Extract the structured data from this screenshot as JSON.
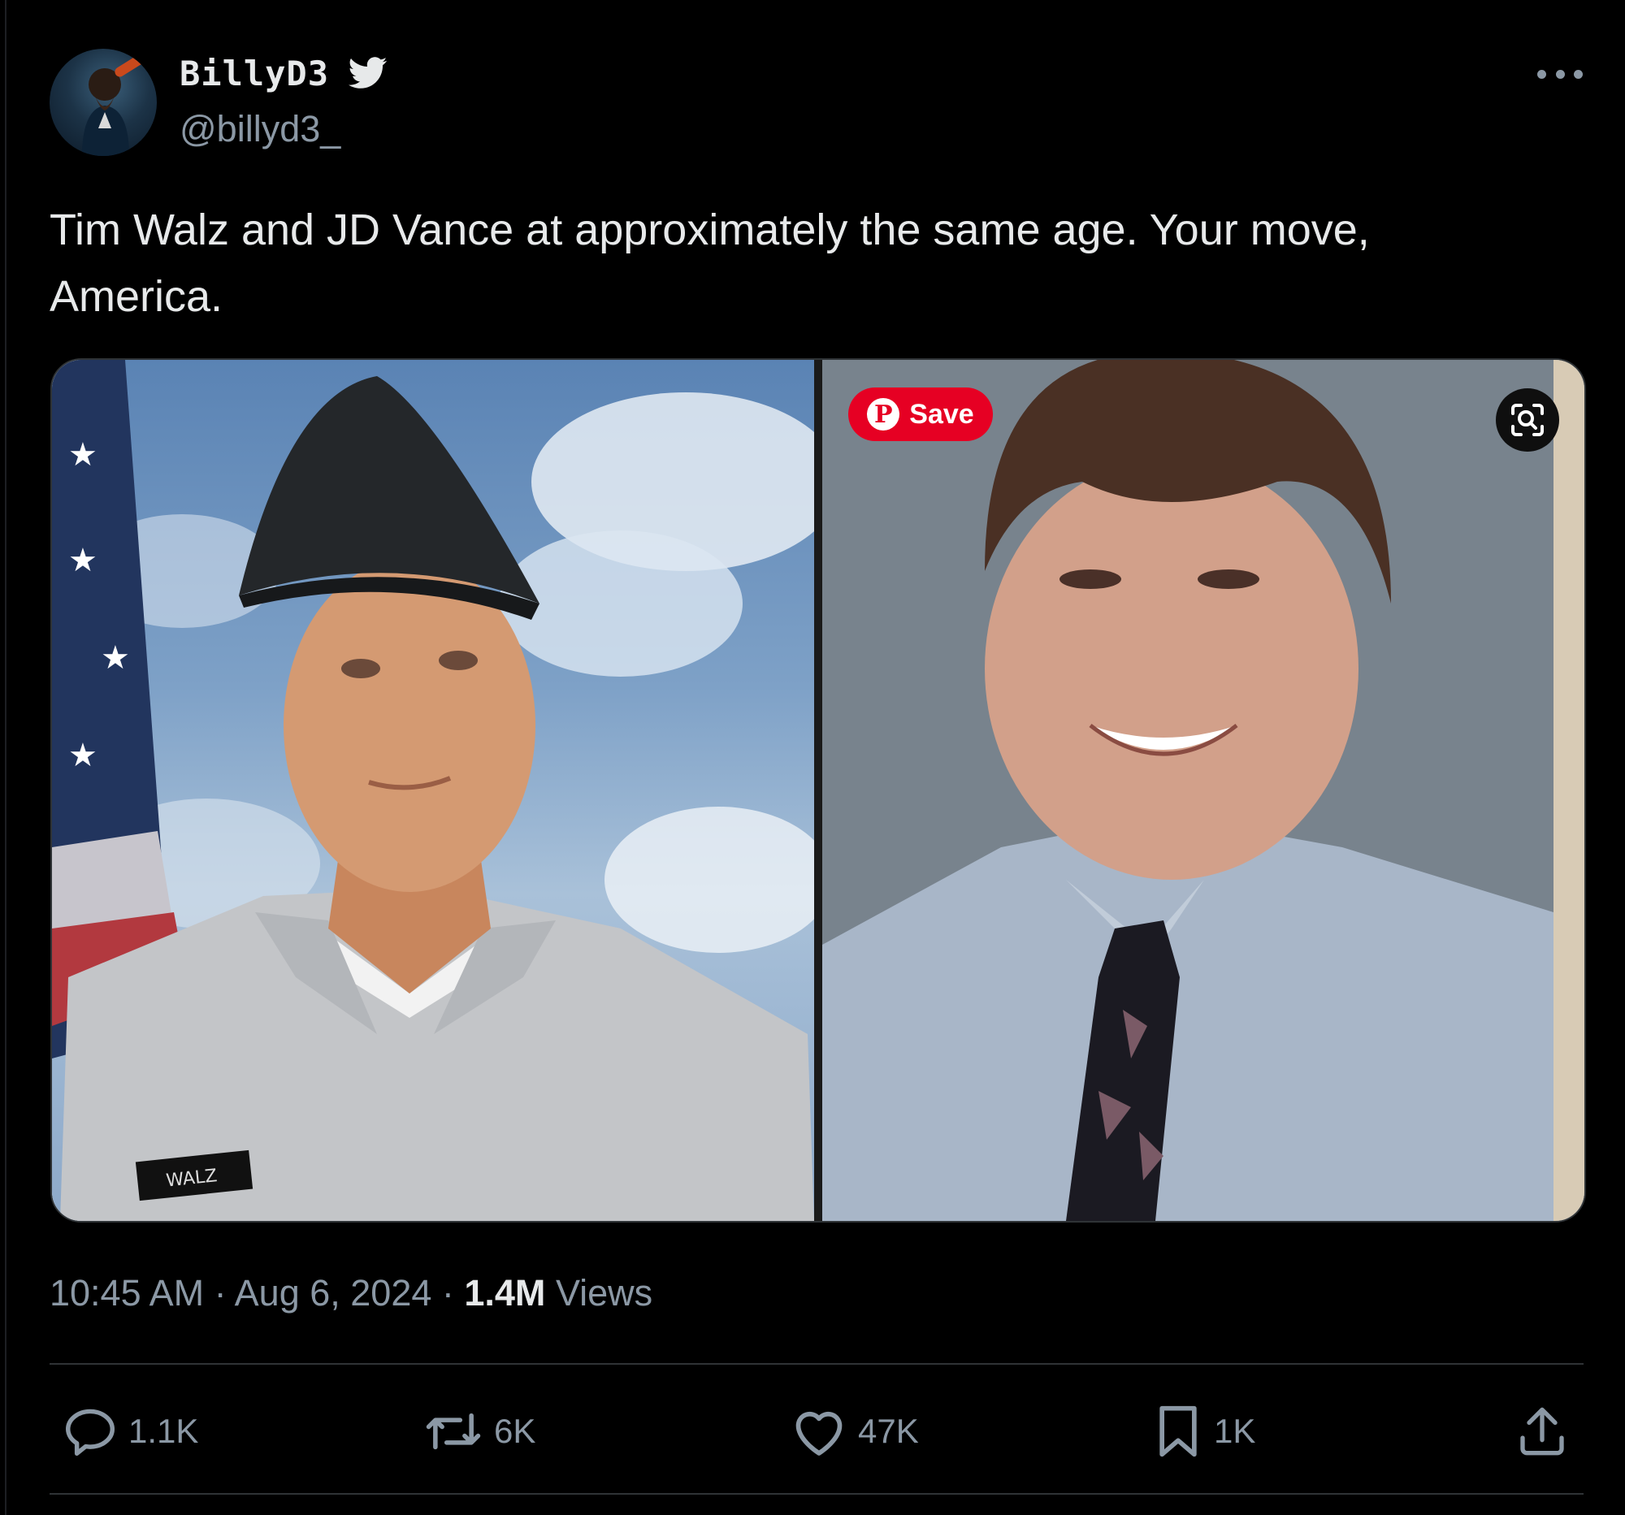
{
  "author": {
    "display_name": "BillyD3",
    "handle": "@billyd3_",
    "verified_icon": "twitter-bird-icon"
  },
  "tweet": {
    "text_line1": "Tim Walz and JD Vance at approximately the same age. Your move,",
    "text_line2": "America."
  },
  "media": {
    "left_photo_label": "WALZ",
    "pin_button_label": "Save",
    "lens_icon": "visual-search-icon"
  },
  "meta": {
    "time": "10:45 AM",
    "separator": " · ",
    "date": "Aug 6, 2024",
    "views_count": "1.4M",
    "views_label": "Views"
  },
  "actions": {
    "replies": "1.1K",
    "retweets": "6K",
    "likes": "47K",
    "bookmarks": "1K"
  },
  "colors": {
    "background": "#000000",
    "text": "#e7e9ea",
    "muted": "#8b98a5",
    "divider": "#2f3336",
    "pinterest_red": "#e60023",
    "twitter_blue_icon": "#e7e9ea"
  }
}
